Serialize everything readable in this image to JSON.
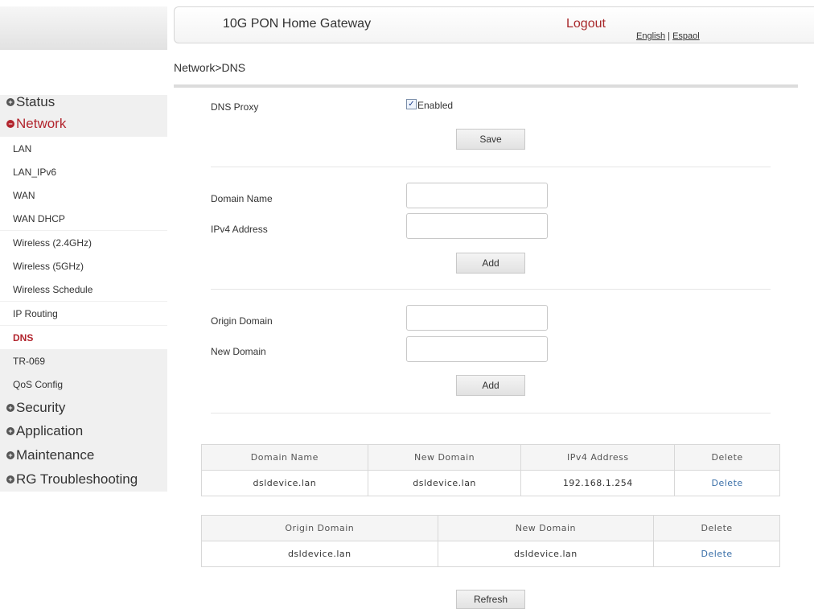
{
  "header": {
    "title": "10G PON Home Gateway",
    "logout": "Logout",
    "lang_english": "English",
    "lang_sep": " | ",
    "lang_espanol": "Espaol"
  },
  "breadcrumb": "Network>DNS",
  "sidebar": {
    "groups": {
      "status": "Status",
      "network": "Network",
      "security": "Security",
      "application": "Application",
      "maintenance": "Maintenance",
      "troubleshooting": "RG Troubleshooting"
    },
    "network_items": [
      "LAN",
      "LAN_IPv6",
      "WAN",
      "WAN DHCP",
      "Wireless (2.4GHz)",
      "Wireless (5GHz)",
      "Wireless Schedule",
      "IP Routing",
      "DNS",
      "TR-069",
      "QoS Config"
    ],
    "active_item": "DNS"
  },
  "dns_proxy": {
    "label": "DNS Proxy",
    "checkbox_label": "Enabled",
    "checked": true,
    "save_label": "Save"
  },
  "host_form": {
    "domain_name_label": "Domain Name",
    "domain_name_value": "",
    "ipv4_label": "IPv4 Address",
    "ipv4_value": "",
    "add_label": "Add"
  },
  "domain_form": {
    "origin_label": "Origin Domain",
    "origin_value": "",
    "new_label": "New Domain",
    "new_value": "",
    "add_label": "Add"
  },
  "host_table": {
    "headers": [
      "Domain Name",
      "New Domain",
      "IPv4 Address",
      "Delete"
    ],
    "rows": [
      {
        "domain_name": "dsldevice.lan",
        "new_domain": "dsldevice.lan",
        "ipv4": "192.168.1.254",
        "delete": "Delete"
      }
    ]
  },
  "domain_table": {
    "headers": [
      "Origin Domain",
      "New Domain",
      "Delete"
    ],
    "rows": [
      {
        "origin_domain": "dsldevice.lan",
        "new_domain": "dsldevice.lan",
        "delete": "Delete"
      }
    ]
  },
  "refresh_label": "Refresh",
  "colors": {
    "accent": "#b2252e",
    "link": "#3a6fa8",
    "sidebar_bg": "#f0f0f0"
  }
}
